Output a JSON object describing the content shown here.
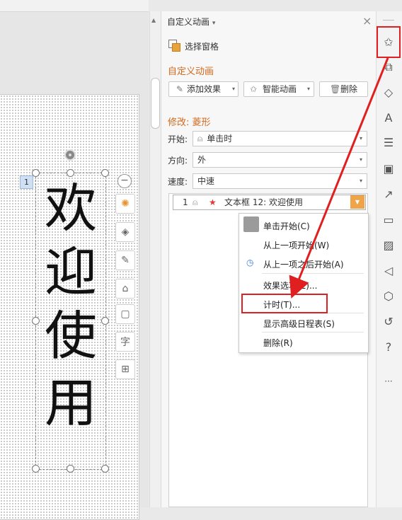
{
  "slide": {
    "animation_index": "1",
    "text_chars": [
      "欢",
      "迎",
      "使",
      "用"
    ]
  },
  "pane": {
    "title": "自定义动画",
    "title_arrow": "▾",
    "close": "×",
    "selection_pane_label": "选择窗格",
    "section_heading": "自定义动画",
    "add_effect_label": "添加效果",
    "smart_anim_label": "智能动画",
    "delete_label": "删除",
    "modify_heading": "修改: 菱形",
    "start_label": "开始:",
    "start_value": "单击时",
    "direction_label": "方向:",
    "direction_value": "外",
    "speed_label": "速度:",
    "speed_value": "中速",
    "list_item": {
      "number": "1",
      "text": "文本框 12: 欢迎使用"
    }
  },
  "context_menu": {
    "items": [
      "单击开始(C)",
      "从上一项开始(W)",
      "从上一项之后开始(A)",
      "效果选项(E)...",
      "计时(T)...",
      "显示高级日程表(S)",
      "删除(R)"
    ]
  },
  "rail_icons": [
    "star-animation-icon",
    "switch-icon",
    "shapes-icon",
    "text-effect-icon",
    "adjust-icon",
    "image-edit-icon",
    "share-icon",
    "archive-icon",
    "picture-icon",
    "sound-icon",
    "shield-icon",
    "history-icon",
    "help-icon",
    "more-icon"
  ],
  "colors": {
    "accent_orange": "#d2691e",
    "annotation_red": "#e02020",
    "row_dropdown": "#f0a44a"
  }
}
